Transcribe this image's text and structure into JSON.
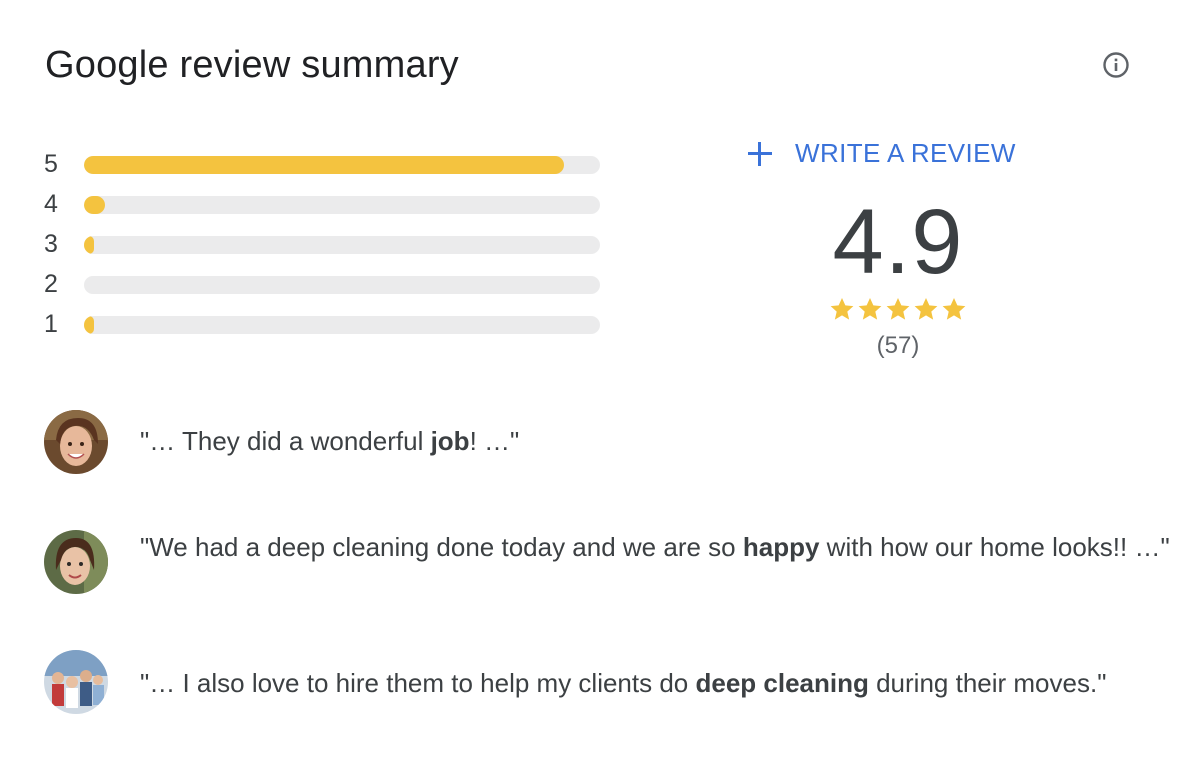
{
  "card": {
    "title": "Google review summary",
    "info_icon": "info-circle-icon"
  },
  "rating_bars": [
    {
      "stars": "5",
      "fraction": 0.93
    },
    {
      "stars": "4",
      "fraction": 0.04
    },
    {
      "stars": "3",
      "fraction": 0.02
    },
    {
      "stars": "2",
      "fraction": 0.0
    },
    {
      "stars": "1",
      "fraction": 0.02
    }
  ],
  "write_review": {
    "icon": "plus-icon",
    "label": "WRITE A REVIEW"
  },
  "summary": {
    "score": "4.9",
    "stars_filled": 5,
    "stars_total": 5,
    "count": "(57)"
  },
  "colors": {
    "bar_fill": "#f4c33f",
    "bar_track": "#ebebec",
    "link_blue": "#3a72d9",
    "star": "#f4c33f"
  },
  "reviews": [
    {
      "avatar": "reviewer-avatar",
      "before": "\"… They did a wonderful ",
      "bold": "job",
      "after": "! …\""
    },
    {
      "avatar": "reviewer-avatar",
      "before": "\"We had a deep cleaning done today and we are so ",
      "bold": "happy",
      "after": " with how our home looks!! …\""
    },
    {
      "avatar": "reviewer-avatar",
      "before": "\"… I also love to hire them to help my clients do ",
      "bold": "deep cleaning",
      "after": " during their moves.\""
    }
  ]
}
